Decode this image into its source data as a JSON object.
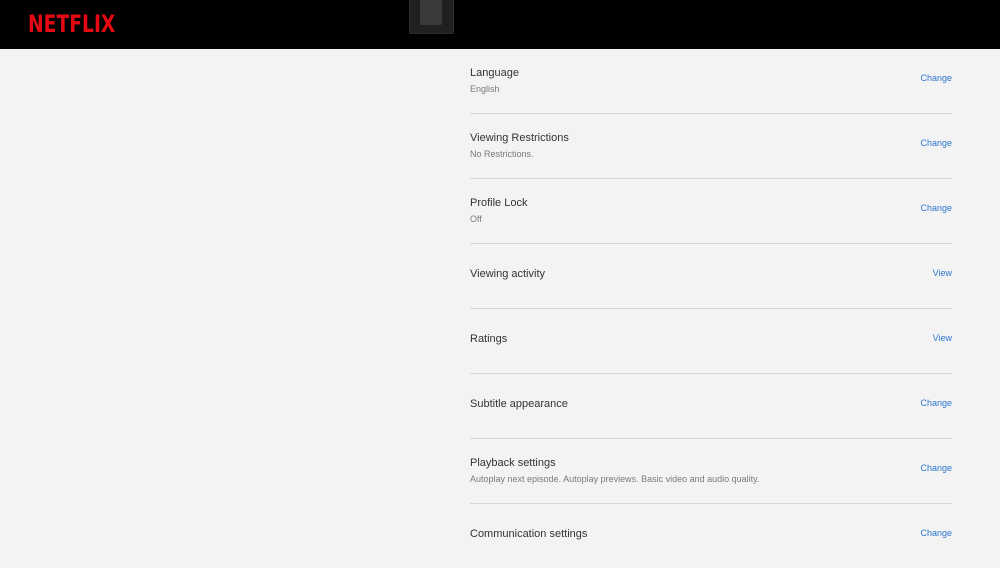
{
  "header": {
    "logo_text": "NETFLIX",
    "brand_color": "#e50914"
  },
  "settings": {
    "rows": [
      {
        "title": "Language",
        "subtitle": "English",
        "action": "Change"
      },
      {
        "title": "Viewing Restrictions",
        "subtitle": "No Restrictions.",
        "action": "Change"
      },
      {
        "title": "Profile Lock",
        "subtitle": "Off",
        "action": "Change"
      },
      {
        "title": "Viewing activity",
        "subtitle": "",
        "action": "View"
      },
      {
        "title": "Ratings",
        "subtitle": "",
        "action": "View"
      },
      {
        "title": "Subtitle appearance",
        "subtitle": "",
        "action": "Change"
      },
      {
        "title": "Playback settings",
        "subtitle": "Autoplay next episode. Autoplay previews. Basic video and audio quality.",
        "action": "Change"
      },
      {
        "title": "Communication settings",
        "subtitle": "",
        "action": "Change"
      }
    ],
    "link_color": "#2d77cf"
  }
}
